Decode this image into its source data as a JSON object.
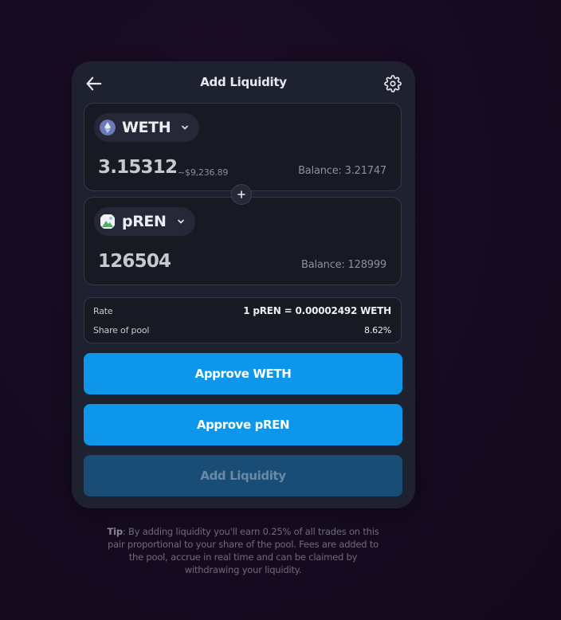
{
  "header": {
    "title": "Add Liquidity",
    "back_icon": "arrow-left-icon",
    "settings_icon": "gear-icon"
  },
  "token_a": {
    "symbol": "WETH",
    "logo_icon": "ethereum-logo-icon",
    "amount": "3.15312",
    "usd_value": "~$9,236.89",
    "balance": "Balance: 3.21747"
  },
  "token_b": {
    "symbol": "pREN",
    "logo_icon": "pren-logo-icon",
    "amount": "126504",
    "balance": "Balance: 128999"
  },
  "plus_icon": "plus-icon",
  "pool_info": {
    "rate_label": "Rate",
    "rate_value": "1 pREN = 0.00002492 WETH",
    "share_label": "Share of pool",
    "share_value": "8.62%"
  },
  "buttons": {
    "approve_a": "Approve WETH",
    "approve_b": "Approve pREN",
    "add_liquidity": "Add Liquidity"
  },
  "tip": {
    "label": "Tip",
    "text": ": By adding liquidity you'll earn 0.25% of all trades on this pair proportional to your share of the pool. Fees are added to the pool, accrue in real time and can be claimed by withdrawing your liquidity."
  },
  "colors": {
    "background": "#170b22",
    "card": "#1e2130",
    "panel": "#171923",
    "primary": "#0d96ea",
    "disabled": "#1a4d75"
  }
}
